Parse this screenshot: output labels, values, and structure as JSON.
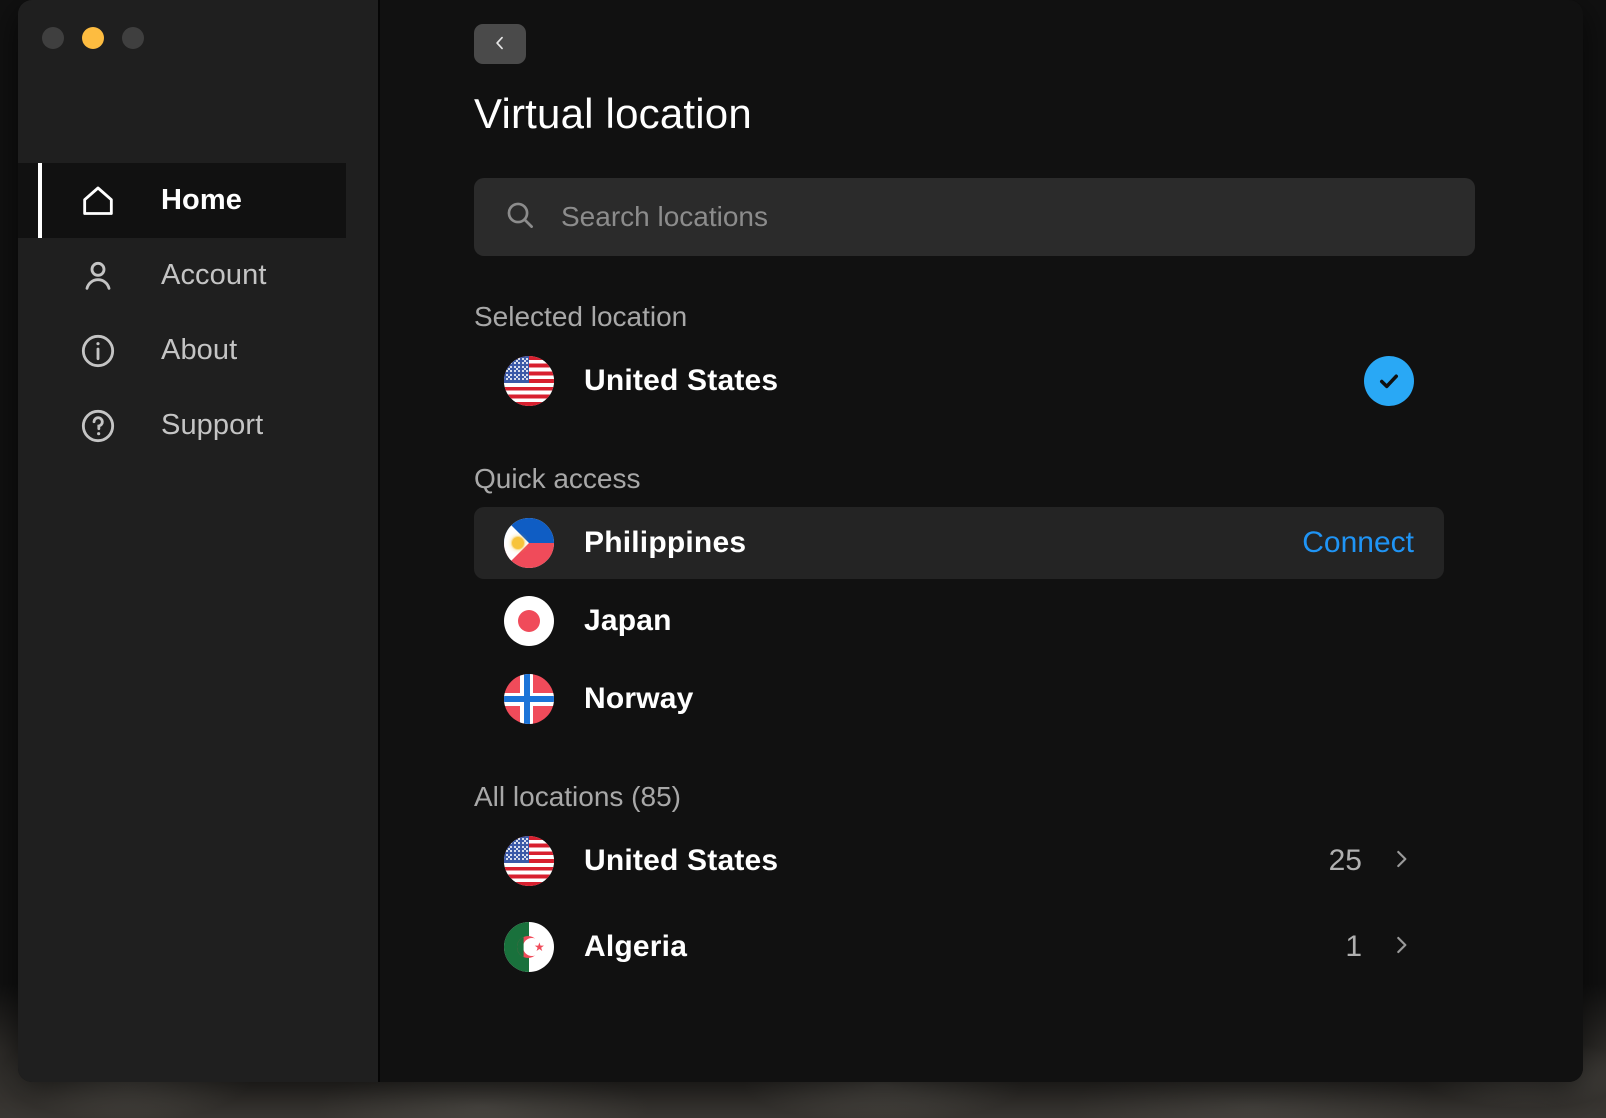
{
  "window": {
    "traffic_lights": [
      {
        "name": "close",
        "color": "#3f3f3f"
      },
      {
        "name": "minimize",
        "color": "#fdbc40"
      },
      {
        "name": "maximize",
        "color": "#3f3f3f"
      }
    ]
  },
  "sidebar": {
    "items": [
      {
        "label": "Home",
        "icon": "home-icon",
        "active": true
      },
      {
        "label": "Account",
        "icon": "user-icon",
        "active": false
      },
      {
        "label": "About",
        "icon": "info-icon",
        "active": false
      },
      {
        "label": "Support",
        "icon": "help-icon",
        "active": false
      }
    ]
  },
  "header": {
    "back_icon": "chevron-left-icon",
    "title": "Virtual location"
  },
  "search": {
    "icon": "search-icon",
    "placeholder": "Search locations",
    "value": ""
  },
  "selected_location": {
    "label": "Selected location",
    "item": {
      "name": "United States",
      "flag": "us",
      "status_icon": "check-icon"
    }
  },
  "quick_access": {
    "label": "Quick access",
    "items": [
      {
        "name": "Philippines",
        "flag": "ph",
        "action": "Connect",
        "highlighted": true
      },
      {
        "name": "Japan",
        "flag": "jp",
        "action": "",
        "highlighted": false
      },
      {
        "name": "Norway",
        "flag": "no",
        "action": "",
        "highlighted": false
      }
    ]
  },
  "all_locations": {
    "label": "All locations (85)",
    "count": 85,
    "items": [
      {
        "name": "United States",
        "flag": "us",
        "count": "25",
        "chevron": "chevron-right-icon"
      },
      {
        "name": "Algeria",
        "flag": "dz",
        "count": "1",
        "chevron": "chevron-right-icon"
      }
    ]
  },
  "colors": {
    "accent_blue": "#1f94f5",
    "badge_blue": "#29a8f5",
    "window_bg": "#111111",
    "sidebar_bg": "#1f1f1f",
    "search_bg": "#2b2b2b",
    "row_highlight": "#242424"
  }
}
